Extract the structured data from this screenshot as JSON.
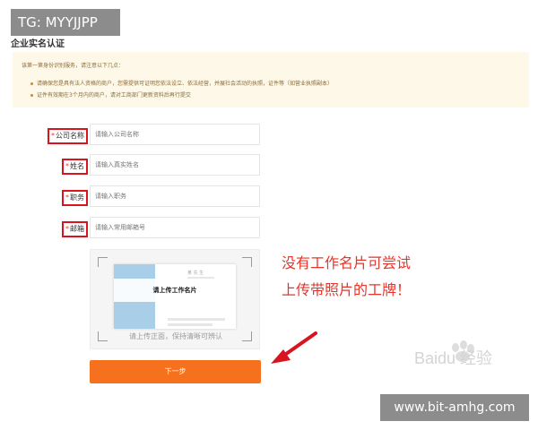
{
  "watermarks": {
    "top_left": "TG: MYYJJPP",
    "bottom_right": "www.bit-amhg.com",
    "baidu": "Baidu 经验"
  },
  "page": {
    "title": "企业实名认证"
  },
  "notice": {
    "heading": "该第一第身份识别服务，请注意以下几点：",
    "items": [
      "请确保您是具有法人资格的商户，您需提供可证明您依法设立、依法经营，并展社会活动的执照，证件等（如营业执照副本）",
      "证件有效期在3个月内的商户，请对工商部门更新资料后再行提交"
    ]
  },
  "form": {
    "required_mark": "*",
    "fields": [
      {
        "label": "公司名称",
        "placeholder": "请输入公司名称"
      },
      {
        "label": "姓名",
        "placeholder": "请输入真实姓名"
      },
      {
        "label": "职务",
        "placeholder": "请输入职务"
      },
      {
        "label": "邮箱",
        "placeholder": "请输入常用邮箱号"
      }
    ]
  },
  "upload": {
    "overlay_text": "请上传工作名片",
    "tip": "请上传正面，保持清晰可辨认",
    "card_name": "某 先 生"
  },
  "next_button": "下一步",
  "annotation": {
    "line1": "没有工作名片可尝试",
    "line2": "上传带照片的工牌！"
  },
  "colors": {
    "accent": "#f5711e",
    "highlight_box": "#d9141e",
    "annotation": "#e6352b",
    "notice_bg": "#fdf8e8"
  }
}
